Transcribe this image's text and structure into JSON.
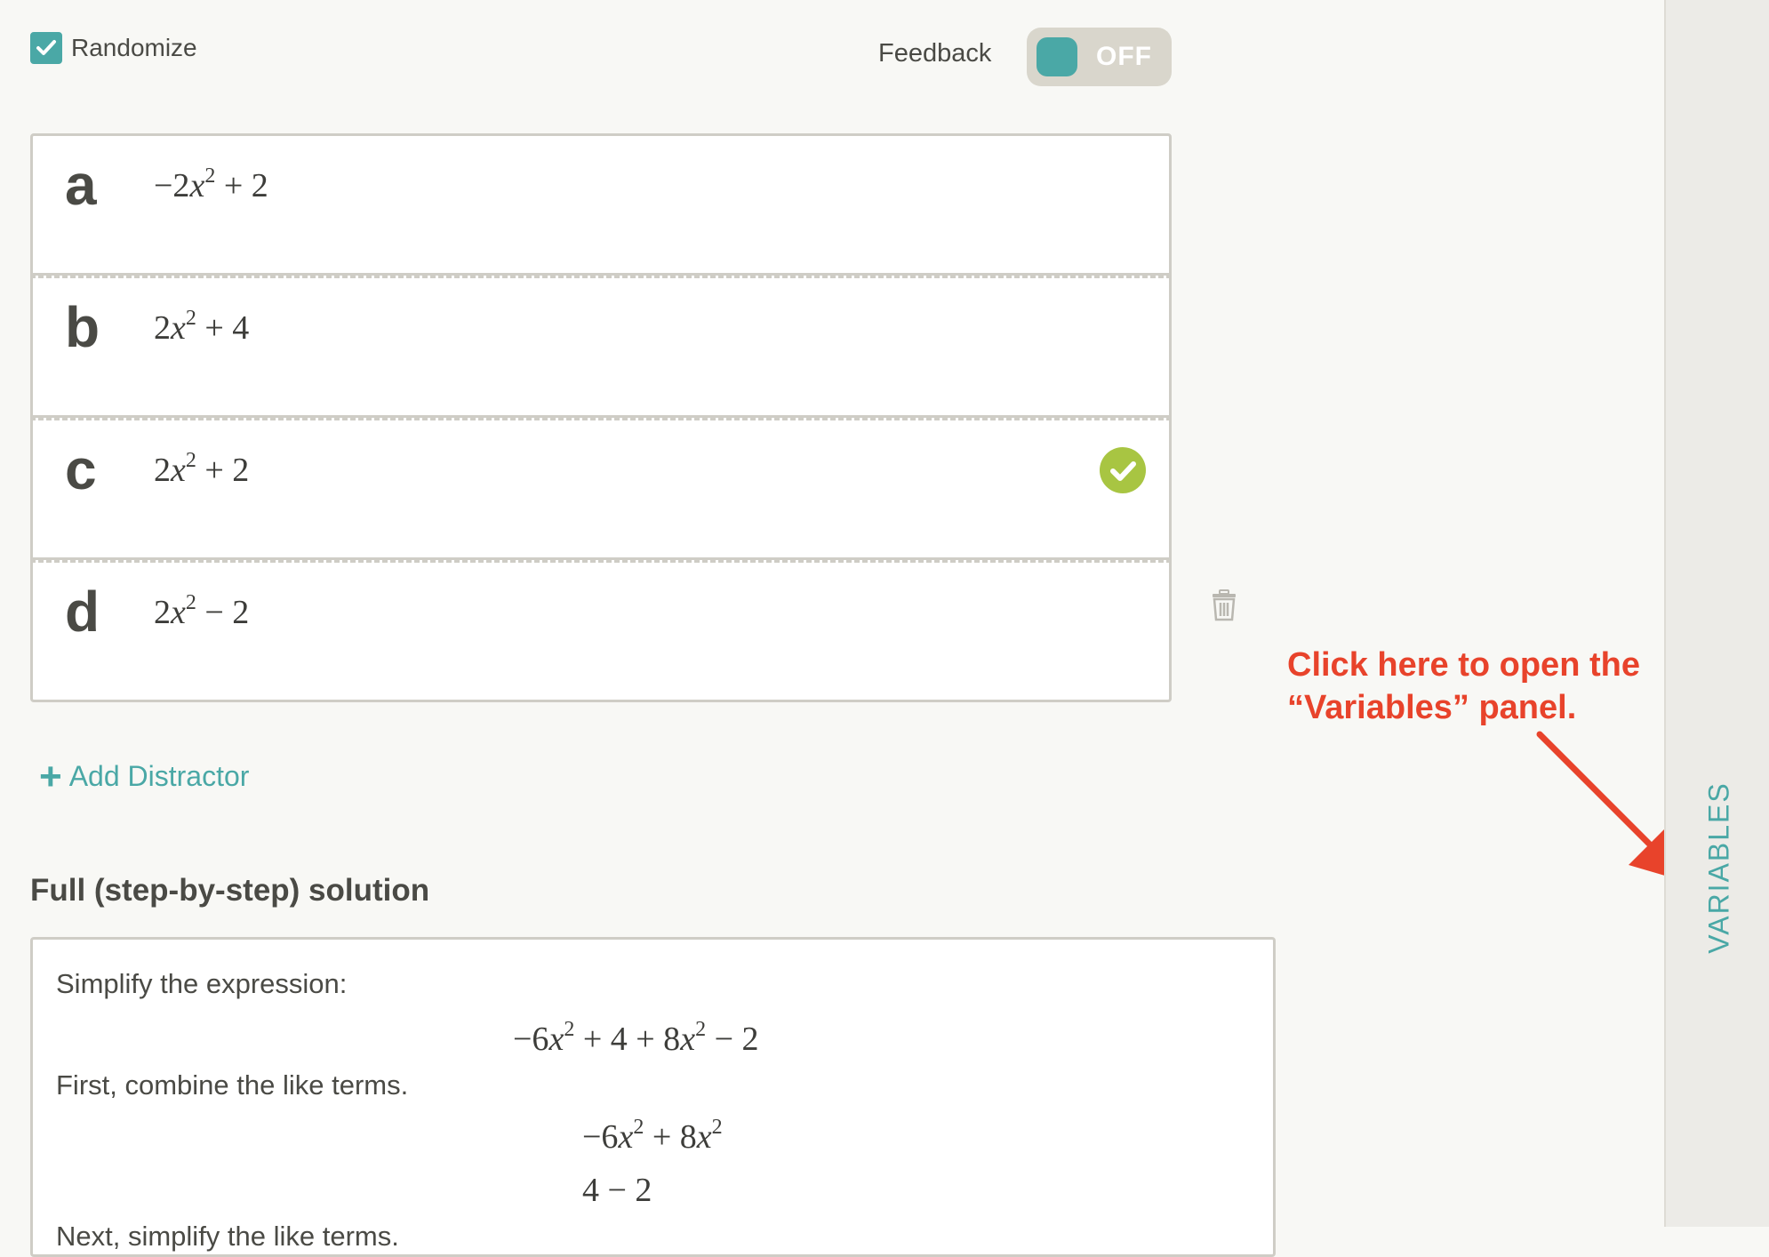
{
  "header": {
    "randomize_label": "Randomize",
    "randomize_checked": true,
    "feedback_label": "Feedback",
    "feedback_toggle_state": "OFF"
  },
  "options": [
    {
      "letter": "a",
      "expression_display": "−2x² + 2",
      "correct": false
    },
    {
      "letter": "b",
      "expression_display": "2x² + 4",
      "correct": false
    },
    {
      "letter": "c",
      "expression_display": "2x² + 2",
      "correct": true
    },
    {
      "letter": "d",
      "expression_display": "2x² − 2",
      "correct": false
    }
  ],
  "add_distractor_label": "Add Distractor",
  "solution": {
    "heading": "Full (step-by-step) solution",
    "line1": "Simplify the expression:",
    "math1": "−6x² + 4 + 8x² − 2",
    "line2": "First, combine the like terms.",
    "math2": "−6x² + 8x²",
    "math3": "4 − 2",
    "line3": "Next, simplify the like terms."
  },
  "annotation": {
    "text": "Click here to open the\n“Variables” panel."
  },
  "side_panel": {
    "label": "VARIABLES"
  },
  "colors": {
    "accent": "#4aa8a6",
    "correct": "#a8c542",
    "annotation": "#e8432b"
  }
}
